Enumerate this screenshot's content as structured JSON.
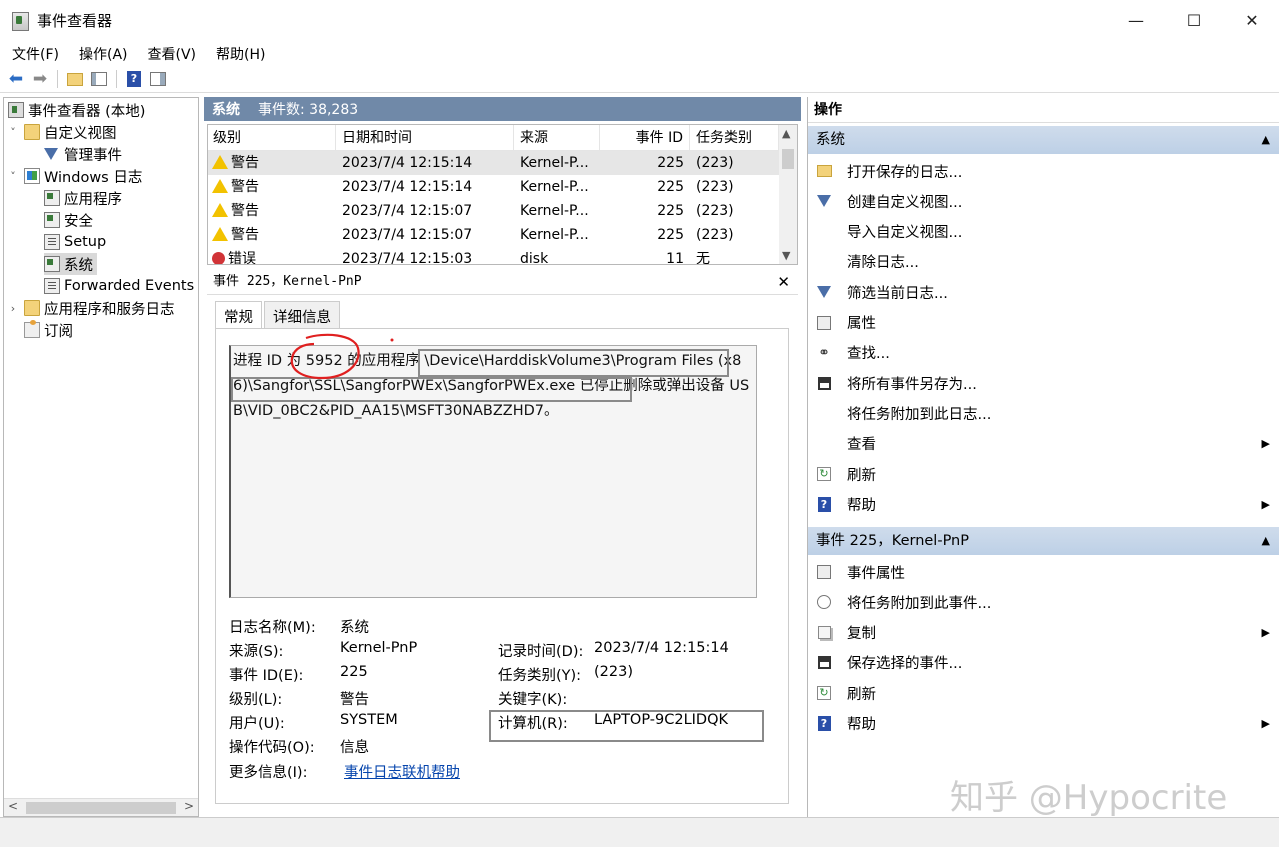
{
  "window": {
    "title": "事件查看器",
    "minimize": "—",
    "maximize": "☐",
    "close": "✕"
  },
  "menu": [
    "文件(F)",
    "操作(A)",
    "查看(V)",
    "帮助(H)"
  ],
  "toolbar_icons": [
    "back-arrow-icon",
    "forward-arrow-icon",
    "folder-up-icon",
    "show-hide-tree-icon",
    "help-icon",
    "action-pane-icon"
  ],
  "tree": {
    "root": "事件查看器 (本地)",
    "custom_views": "自定义视图",
    "admin_events": "管理事件",
    "windows_logs": "Windows 日志",
    "application": "应用程序",
    "security": "安全",
    "setup": "Setup",
    "system": "系统",
    "forwarded": "Forwarded Events",
    "apps_services": "应用程序和服务日志",
    "subscriptions": "订阅"
  },
  "log_header": {
    "name": "系统",
    "count": "事件数: 38,283"
  },
  "grid": {
    "columns": [
      "级别",
      "日期和时间",
      "来源",
      "事件 ID",
      "任务类别"
    ],
    "rows": [
      {
        "level": "警告",
        "type": "warning",
        "datetime": "2023/7/4 12:15:14",
        "source": "Kernel-P...",
        "event_id": "225",
        "task": "(223)"
      },
      {
        "level": "警告",
        "type": "warning",
        "datetime": "2023/7/4 12:15:14",
        "source": "Kernel-P...",
        "event_id": "225",
        "task": "(223)"
      },
      {
        "level": "警告",
        "type": "warning",
        "datetime": "2023/7/4 12:15:07",
        "source": "Kernel-P...",
        "event_id": "225",
        "task": "(223)"
      },
      {
        "level": "警告",
        "type": "warning",
        "datetime": "2023/7/4 12:15:07",
        "source": "Kernel-P...",
        "event_id": "225",
        "task": "(223)"
      },
      {
        "level": "错误",
        "type": "error",
        "datetime": "2023/7/4 12:15:03",
        "source": "disk",
        "event_id": "11",
        "task": "无"
      }
    ]
  },
  "detail": {
    "title": "事件 225，Kernel-PnP",
    "close": "✕",
    "tabs": [
      "常规",
      "详细信息"
    ],
    "message": "进程 ID 为 5952 的应用程序 \\Device\\HarddiskVolume3\\Program Files (x86)\\Sangfor\\SSL\\SangforPWEx\\SangforPWEx.exe 已停止删除或弹出设备 USB\\VID_0BC2&PID_AA15\\MSFT30NABZZHD7。",
    "fields": {
      "log_name_label": "日志名称(M):",
      "log_name": "系统",
      "source_label": "来源(S):",
      "source": "Kernel-PnP",
      "logged_label": "记录时间(D):",
      "logged": "2023/7/4 12:15:14",
      "event_id_label": "事件 ID(E):",
      "event_id": "225",
      "task_label": "任务类别(Y):",
      "task": "(223)",
      "level_label": "级别(L):",
      "level": "警告",
      "keywords_label": "关键字(K):",
      "keywords": "",
      "user_label": "用户(U):",
      "user": "SYSTEM",
      "computer_label": "计算机(R):",
      "computer": "LAPTOP-9C2LIDQK",
      "opcode_label": "操作代码(O):",
      "opcode": "信息",
      "more_label": "更多信息(I):",
      "more_link": "事件日志联机帮助"
    }
  },
  "actions": {
    "title": "操作",
    "section1": "系统",
    "items1": [
      {
        "label": "打开保存的日志...",
        "icon": "open-folder-icon"
      },
      {
        "label": "创建自定义视图...",
        "icon": "filter-icon"
      },
      {
        "label": "导入自定义视图...",
        "icon": ""
      },
      {
        "label": "清除日志...",
        "icon": ""
      },
      {
        "label": "筛选当前日志...",
        "icon": "filter-icon"
      },
      {
        "label": "属性",
        "icon": "properties-icon"
      },
      {
        "label": "查找...",
        "icon": "binoculars-icon"
      },
      {
        "label": "将所有事件另存为...",
        "icon": "save-icon"
      },
      {
        "label": "将任务附加到此日志...",
        "icon": ""
      },
      {
        "label": "查看",
        "icon": "",
        "submenu": true
      },
      {
        "label": "刷新",
        "icon": "refresh-icon"
      },
      {
        "label": "帮助",
        "icon": "help-icon",
        "submenu": true
      }
    ],
    "section2": "事件 225，Kernel-PnP",
    "items2": [
      {
        "label": "事件属性",
        "icon": "properties-icon"
      },
      {
        "label": "将任务附加到此事件...",
        "icon": "task-icon"
      },
      {
        "label": "复制",
        "icon": "copy-icon",
        "submenu": true
      },
      {
        "label": "保存选择的事件...",
        "icon": "save-icon"
      },
      {
        "label": "刷新",
        "icon": "refresh-icon"
      },
      {
        "label": "帮助",
        "icon": "help-icon",
        "submenu": true
      }
    ]
  },
  "watermark": "知乎 @Hypocrite",
  "colors": {
    "header_blue": "#7089a8",
    "section_blue": "#c6d6ea",
    "warning": "#f2c200",
    "error": "#d13438",
    "annotation_red": "#e02020"
  }
}
